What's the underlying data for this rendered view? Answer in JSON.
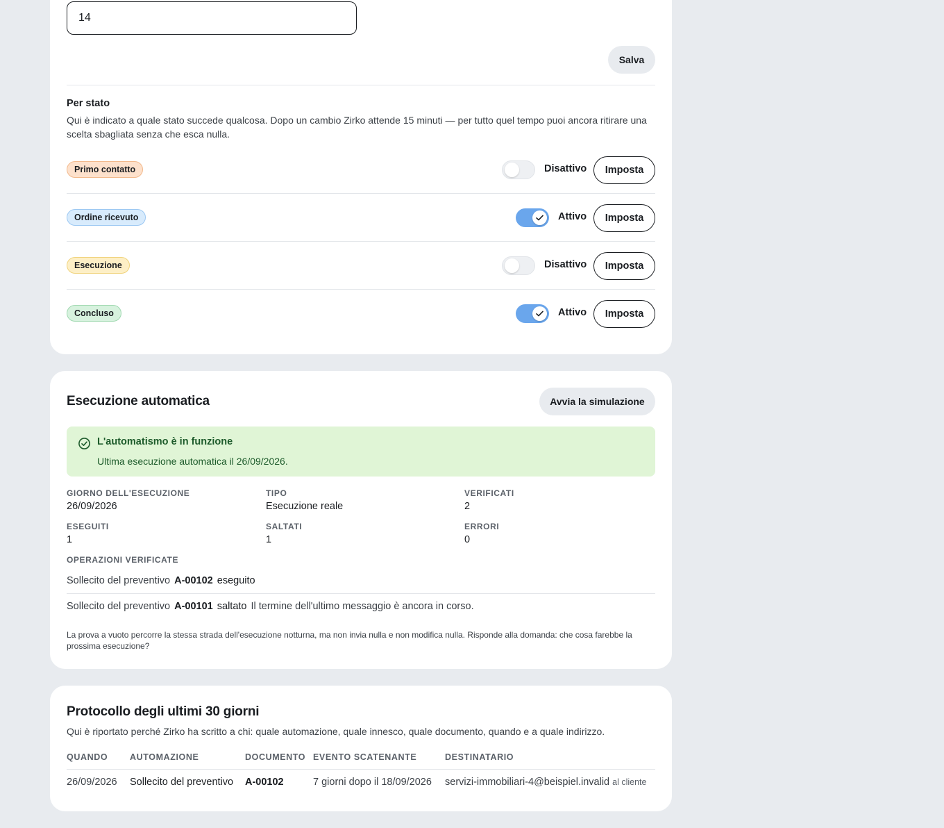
{
  "threshold": {
    "value": "14",
    "save_label": "Salva"
  },
  "per_stato": {
    "title": "Per stato",
    "description": "Qui è indicato a quale stato succede qualcosa. Dopo un cambio Zirko attende 15 minuti — per tutto quel tempo puoi ancora ritirare una scelta sbagliata senza che esca nulla.",
    "configure_label": "Imposta",
    "rows": [
      {
        "badge": "Primo contatto",
        "status": "Disattivo",
        "enabled": false,
        "badge_color": "#fde1cc"
      },
      {
        "badge": "Ordine ricevuto",
        "status": "Attivo",
        "enabled": true,
        "badge_color": "#d8ebfc"
      },
      {
        "badge": "Esecuzione",
        "status": "Disattivo",
        "enabled": false,
        "badge_color": "#fdefc6"
      },
      {
        "badge": "Concluso",
        "status": "Attivo",
        "enabled": true,
        "badge_color": "#d7f2de"
      }
    ]
  },
  "esecuzione": {
    "title": "Esecuzione automatica",
    "simulate_label": "Avvia la simulazione",
    "alert": {
      "title": "L'automatismo è in funzione",
      "text": "Ultima esecuzione automatica il 26/09/2026.",
      "icon": "check-circle-icon",
      "color": "#1d5b2b"
    },
    "stats": [
      {
        "label": "GIORNO DELL'ESECUZIONE",
        "value": "26/09/2026"
      },
      {
        "label": "TIPO",
        "value": "Esecuzione reale"
      },
      {
        "label": "VERIFICATI",
        "value": "2"
      },
      {
        "label": "ESEGUITI",
        "value": "1"
      },
      {
        "label": "SALTATI",
        "value": "1"
      },
      {
        "label": "ERRORI",
        "value": "0"
      }
    ],
    "operations_label": "OPERAZIONI VERIFICATE",
    "operations": [
      {
        "type": "Sollecito del preventivo",
        "doc": "A-00102",
        "status": "eseguito",
        "reason": ""
      },
      {
        "type": "Sollecito del preventivo",
        "doc": "A-00101",
        "status": "saltato",
        "reason": "Il termine dell'ultimo messaggio è ancora in corso."
      }
    ],
    "note": "La prova a vuoto percorre la stessa strada dell'esecuzione notturna, ma non invia nulla e non modifica nulla. Risponde alla domanda: che cosa farebbe la prossima esecuzione?"
  },
  "protocollo": {
    "title": "Protocollo degli ultimi 30 giorni",
    "description": "Qui è riportato perché Zirko ha scritto a chi: quale automazione, quale innesco, quale documento, quando e a quale indirizzo.",
    "columns": [
      "QUANDO",
      "AUTOMAZIONE",
      "DOCUMENTO",
      "EVENTO SCATENANTE",
      "DESTINATARIO"
    ],
    "rows": [
      {
        "when": "26/09/2026",
        "automation": "Sollecito del preventivo",
        "document": "A-00102",
        "trigger": "7 giorni dopo il 18/09/2026",
        "recipient": "servizi-immobiliari-4@beispiel.invalid",
        "recipient_note": "al cliente"
      }
    ]
  }
}
